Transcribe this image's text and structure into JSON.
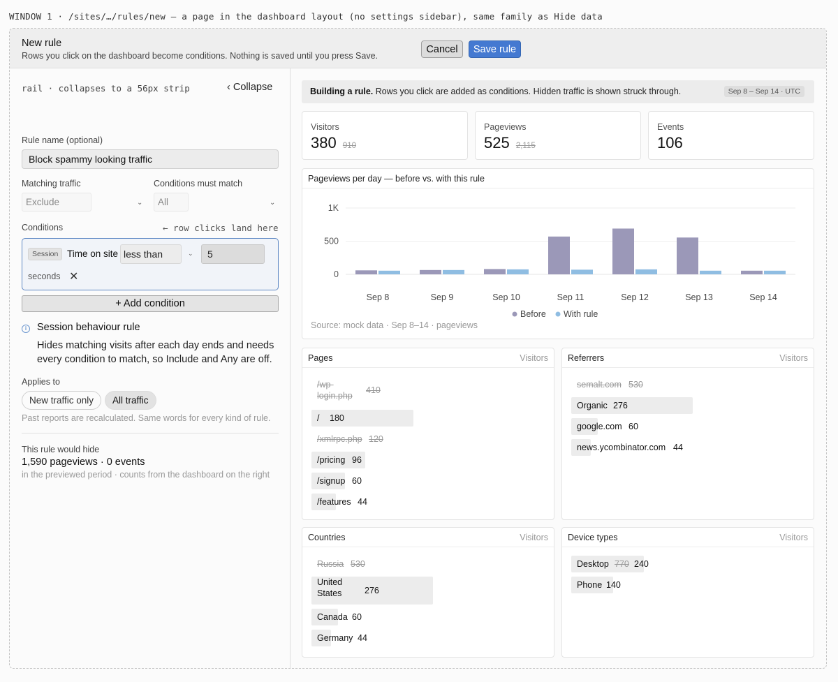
{
  "caption": "WINDOW 1 · /sites/…/rules/new — a page in the dashboard layout (no settings sidebar), same family as Hide data",
  "header": {
    "title": "New rule",
    "subtitle": "Rows you click on the dashboard become conditions. Nothing is saved until you press Save.",
    "cancel_label": "Cancel",
    "save_label": "Save rule"
  },
  "rail": {
    "note": "rail · collapses to a 56px strip",
    "collapse_label": "‹ Collapse",
    "rule_name_label": "Rule name (optional)",
    "rule_name_value": "Block spammy looking traffic",
    "matching_label": "Matching traffic",
    "matching_value": "Exclude",
    "must_match_label": "Conditions must match",
    "must_match_value": "All",
    "conditions_label": "Conditions",
    "conditions_hint": "← row clicks land here",
    "condition": {
      "tag": "Session",
      "field": "Time on site",
      "operator": "less than",
      "value": "5",
      "unit": "seconds"
    },
    "add_condition_label": "+ Add condition",
    "info_title": "Session behaviour rule",
    "info_body": "Hides matching visits after each day ends and needs every condition to match, so Include and Any are off.",
    "applies_label": "Applies to",
    "applies_options": [
      "New traffic only",
      "All traffic"
    ],
    "applies_selected": "All traffic",
    "applies_note": "Past reports are recalculated. Same words for every kind of rule.",
    "would_hide_label": "This rule would hide",
    "would_hide_value": "1,590 pageviews · 0 events",
    "would_hide_note": "in the previewed period · counts from the dashboard on the right"
  },
  "banner": {
    "bold": "Building a rule.",
    "text": " Rows you click are added as conditions. Hidden traffic is shown struck through.",
    "date_range": "Sep 8 – Sep 14 · UTC"
  },
  "stats": [
    {
      "label": "Visitors",
      "value": "380",
      "old": "910"
    },
    {
      "label": "Pageviews",
      "value": "525",
      "old": "2,115"
    },
    {
      "label": "Events",
      "value": "106",
      "old": ""
    }
  ],
  "chart_panel_title": "Pageviews per day — before vs. with this rule",
  "chart_data": {
    "type": "bar",
    "title": "Pageviews per day — before vs. with this rule",
    "categories": [
      "Sep 8",
      "Sep 9",
      "Sep 10",
      "Sep 11",
      "Sep 12",
      "Sep 13",
      "Sep 14"
    ],
    "series": [
      {
        "name": "Before",
        "color": "#9b98b8",
        "values": [
          60,
          65,
          80,
          570,
          690,
          555,
          55
        ]
      },
      {
        "name": "With rule",
        "color": "#8fbde2",
        "values": [
          55,
          65,
          75,
          70,
          75,
          55,
          55
        ]
      }
    ],
    "y_ticks": [
      "1K",
      "500",
      "0"
    ],
    "y_tick_values": [
      1000,
      500,
      0
    ],
    "ylim": [
      0,
      1000
    ],
    "legend_position": "bottom-center",
    "source": "Source: mock data · Sep 8–14 · pageviews"
  },
  "pages": {
    "title": "Pages",
    "column": "Visitors",
    "rows": [
      {
        "name": "/wp-login.php",
        "count": "410",
        "hidden": true,
        "frac": 0
      },
      {
        "name": "/",
        "count": "180",
        "hidden": false,
        "frac": 1.0
      },
      {
        "name": "/xmlrpc.php",
        "count": "120",
        "hidden": true,
        "frac": 0
      },
      {
        "name": "/pricing",
        "count": "96",
        "hidden": false,
        "frac": 0.53
      },
      {
        "name": "/signup",
        "count": "60",
        "hidden": false,
        "frac": 0.33
      },
      {
        "name": "/features",
        "count": "44",
        "hidden": false,
        "frac": 0.24
      }
    ]
  },
  "referrers": {
    "title": "Referrers",
    "column": "Visitors",
    "rows": [
      {
        "name": "semalt.com",
        "count": "530",
        "hidden": true,
        "frac": 0
      },
      {
        "name": "Organic",
        "count": "276",
        "hidden": false,
        "frac": 1.0
      },
      {
        "name": "google.com",
        "count": "60",
        "hidden": false,
        "frac": 0.22
      },
      {
        "name": "news.ycombinator.com",
        "count": "44",
        "hidden": false,
        "frac": 0.16
      }
    ]
  },
  "countries": {
    "title": "Countries",
    "column": "Visitors",
    "rows": [
      {
        "name": "Russia",
        "count": "530",
        "hidden": true,
        "frac": 0
      },
      {
        "name": "United States",
        "count": "276",
        "hidden": false,
        "frac": 1.0
      },
      {
        "name": "Canada",
        "count": "60",
        "hidden": false,
        "frac": 0.22
      },
      {
        "name": "Germany",
        "count": "44",
        "hidden": false,
        "frac": 0.16
      }
    ]
  },
  "devices": {
    "title": "Device types",
    "column": "Visitors",
    "rows": [
      {
        "name": "Desktop",
        "old": "770",
        "count": "240",
        "hidden": false,
        "frac": 1.0
      },
      {
        "name": "Phone",
        "old": "",
        "count": "140",
        "hidden": false,
        "frac": 0.58
      }
    ]
  }
}
